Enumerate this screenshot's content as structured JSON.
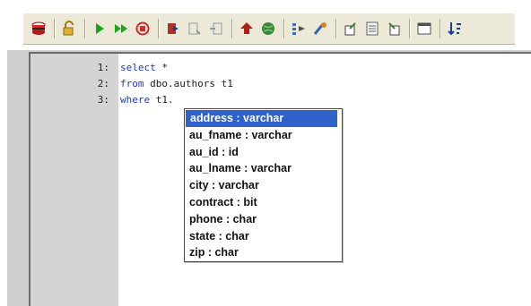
{
  "toolbar": {
    "buttons": [
      {
        "icon": "database-icon",
        "color": "#d42a2a"
      },
      {
        "icon": "unlock-icon",
        "color": "#c8a020"
      },
      {
        "icon": "run-icon",
        "color": "#1aa61a"
      },
      {
        "icon": "run-all-icon",
        "color": "#1aa61a"
      },
      {
        "icon": "stop-icon",
        "color": "#d42a2a"
      },
      {
        "icon": "step-icon",
        "color": "#b03030"
      },
      {
        "icon": "toggle-breakpoint-icon",
        "color": "#8a9aa0"
      },
      {
        "icon": "clear-breakpoints-icon",
        "color": "#8a9aa0"
      },
      {
        "icon": "execution-plan-icon",
        "color": "#b0201a"
      },
      {
        "icon": "globe-icon",
        "color": "#3a8a3a"
      },
      {
        "icon": "explain-icon",
        "color": "#3a6fbf"
      },
      {
        "icon": "tune-icon",
        "color": "#2a6ab0"
      },
      {
        "icon": "export-icon",
        "color": "#408040"
      },
      {
        "icon": "report-icon",
        "color": "#606060"
      },
      {
        "icon": "import-icon",
        "color": "#408040"
      },
      {
        "icon": "window-icon",
        "color": "#505050"
      },
      {
        "icon": "sort-icon",
        "color": "#1b3e8f"
      }
    ]
  },
  "editor": {
    "lines": [
      {
        "number": "1:",
        "keyword": "select",
        "rest": " *"
      },
      {
        "number": "2:",
        "keyword": "from",
        "rest": " dbo.authors t1"
      },
      {
        "number": "3:",
        "keyword": "where",
        "rest": " t1."
      }
    ]
  },
  "autocomplete": {
    "selected_index": 0,
    "items": [
      "address : varchar",
      "au_fname : varchar",
      "au_id : id",
      "au_lname : varchar",
      "city : varchar",
      "contract : bit",
      "phone : char",
      "state : char",
      "zip : char"
    ]
  }
}
